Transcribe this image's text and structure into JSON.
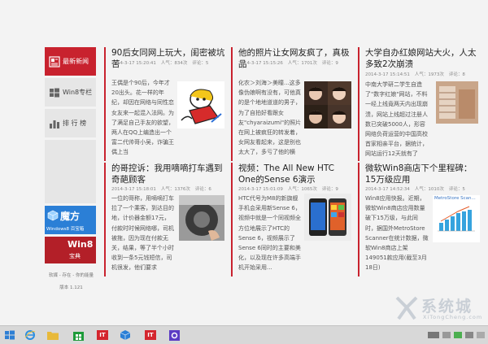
{
  "sidebar": {
    "items": [
      {
        "label": "最新新闻"
      },
      {
        "label": "Win8专栏"
      },
      {
        "label": "排 行 榜"
      }
    ],
    "tiles": [
      {
        "label": "魔方",
        "sub": "Windows8 百宝箱"
      },
      {
        "label": "Win8",
        "sub": "宝典"
      }
    ],
    "footer": "软媒 - 存在 - 你的能量",
    "version": "版本 1.121"
  },
  "articles": [
    {
      "title": "90后女同网上玩大，闺密被坑苦",
      "date": "2014-3-17 15:20:41",
      "views": "人气：834次",
      "comments": "评论：5",
      "body": "王偶是个90后，今年才20出头。花一样的年纪，却因在网络与同性恋女友来一起混入法网。为了满足自己手友的欲望，两人在QQ上编造出一个富二代帅哥小吴，诈骗王偶上当"
    },
    {
      "title": "他的照片让女网友疯了，真极品",
      "date": "2014-3-17 15:15:26",
      "views": "人气：1701次",
      "comments": "评论：9",
      "body": "化农＞刘海＞美瞳...这多像伪娘啊有没有，可他真的是个地地道道的男子，为了自拍好看跟女友\"chyaraizumi\"的照片在网上被疯狂的转发着，女网友看起来，这是别也太大了，多亏了他的横向，以后相..."
    },
    {
      "title": "大学自办红娘网站大火，人太多致2次崩溃",
      "date": "2014-3-17 15:14:51",
      "views": "人气：1973次",
      "comments": "评论：8",
      "body": "中南大学研二学生自造了\"数字红娘\"网站，不料一经上线竟两天内出现崩溃，网站上线超过注册人数已突破5000人，形容网络负荷运营的中国高校首家相亲平台，据统计，网站运行12天就有了8000多注册会员"
    },
    {
      "title": "的哥控诉：我用嘀嘀打车遇到奇葩顾客",
      "date": "2014-3-17 15:18:01",
      "views": "人气：1376次",
      "comments": "评论：6",
      "body": "一位的哥称，用嘀嘀打车拉了一个乘客，到达目的地，计价器金额17元，付款时时候网络哪，司机被拖，因为现在付款无关，结果，等了半个小时收到一条5元钱短信，司机很发，他们要求"
    },
    {
      "title": "视频：The All New HTC One的Sense 6演示",
      "date": "2014-3-17 15:01:09",
      "views": "人气：1065次",
      "comments": "评论：9",
      "body": "HTC代号为M8的新旗舰手机会采用新Sense 6，视频中就是一个同视频全方位地展示了HTC的Sense 6，视频展示了Sense 6同时的主要和美化，以及现在许多高端手机开始采用..."
    },
    {
      "title": "微软Win8商店下个里程碑：15万级应用",
      "date": "2014-3-17 14:52:34",
      "views": "人气：1010次",
      "comments": "评论：5",
      "body": "Win8应用快报。近期，微软Win8商店应用数量破下15万级，与此同时，据国外MetroStore Scanner在统计数据，微软Win8商店上架149051款应用(截至3月18日)",
      "chart_label": "MetroStore Scan..."
    }
  ],
  "watermark": {
    "text": "系统城",
    "url": "XiTongCheng.com"
  },
  "taskbar": {
    "items": [
      "start-button",
      "ie-icon",
      "explorer-icon",
      "store-icon",
      "ithome-icon",
      "mofang-icon",
      "ruanmei-icon",
      "settings-icon"
    ]
  },
  "colors": {
    "accent": "#c8222e",
    "tile_blue": "#2b7fd6",
    "background": "#f3f3f3"
  }
}
